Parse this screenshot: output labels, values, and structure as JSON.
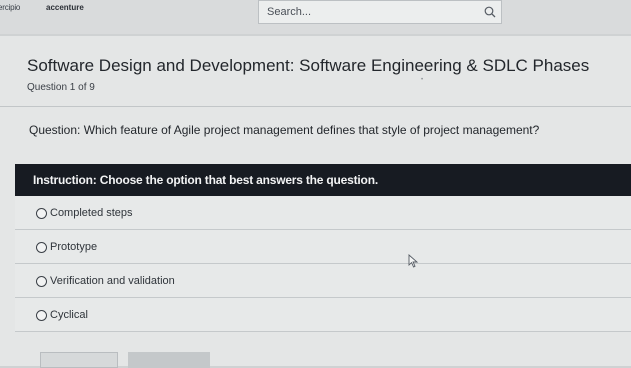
{
  "header": {
    "logo_left": "ercipio",
    "logo_right": "accenture",
    "search": {
      "placeholder": "Search...",
      "value": ""
    }
  },
  "course": {
    "title": "Software Design and Development: Software Engineering & SDLC Phases",
    "progress": "Question 1 of 9"
  },
  "question": {
    "prefix": "Question:",
    "text": " Which feature of Agile project management defines that style of project management?"
  },
  "instruction": {
    "text": "Instruction: Choose the option that best answers the question."
  },
  "options": [
    {
      "label": "Completed steps"
    },
    {
      "label": "Prototype"
    },
    {
      "label": "Verification and validation"
    },
    {
      "label": "Cyclical"
    }
  ],
  "colors": {
    "instruction_bar": "#171b22",
    "page_bg": "#e4e6e6"
  }
}
